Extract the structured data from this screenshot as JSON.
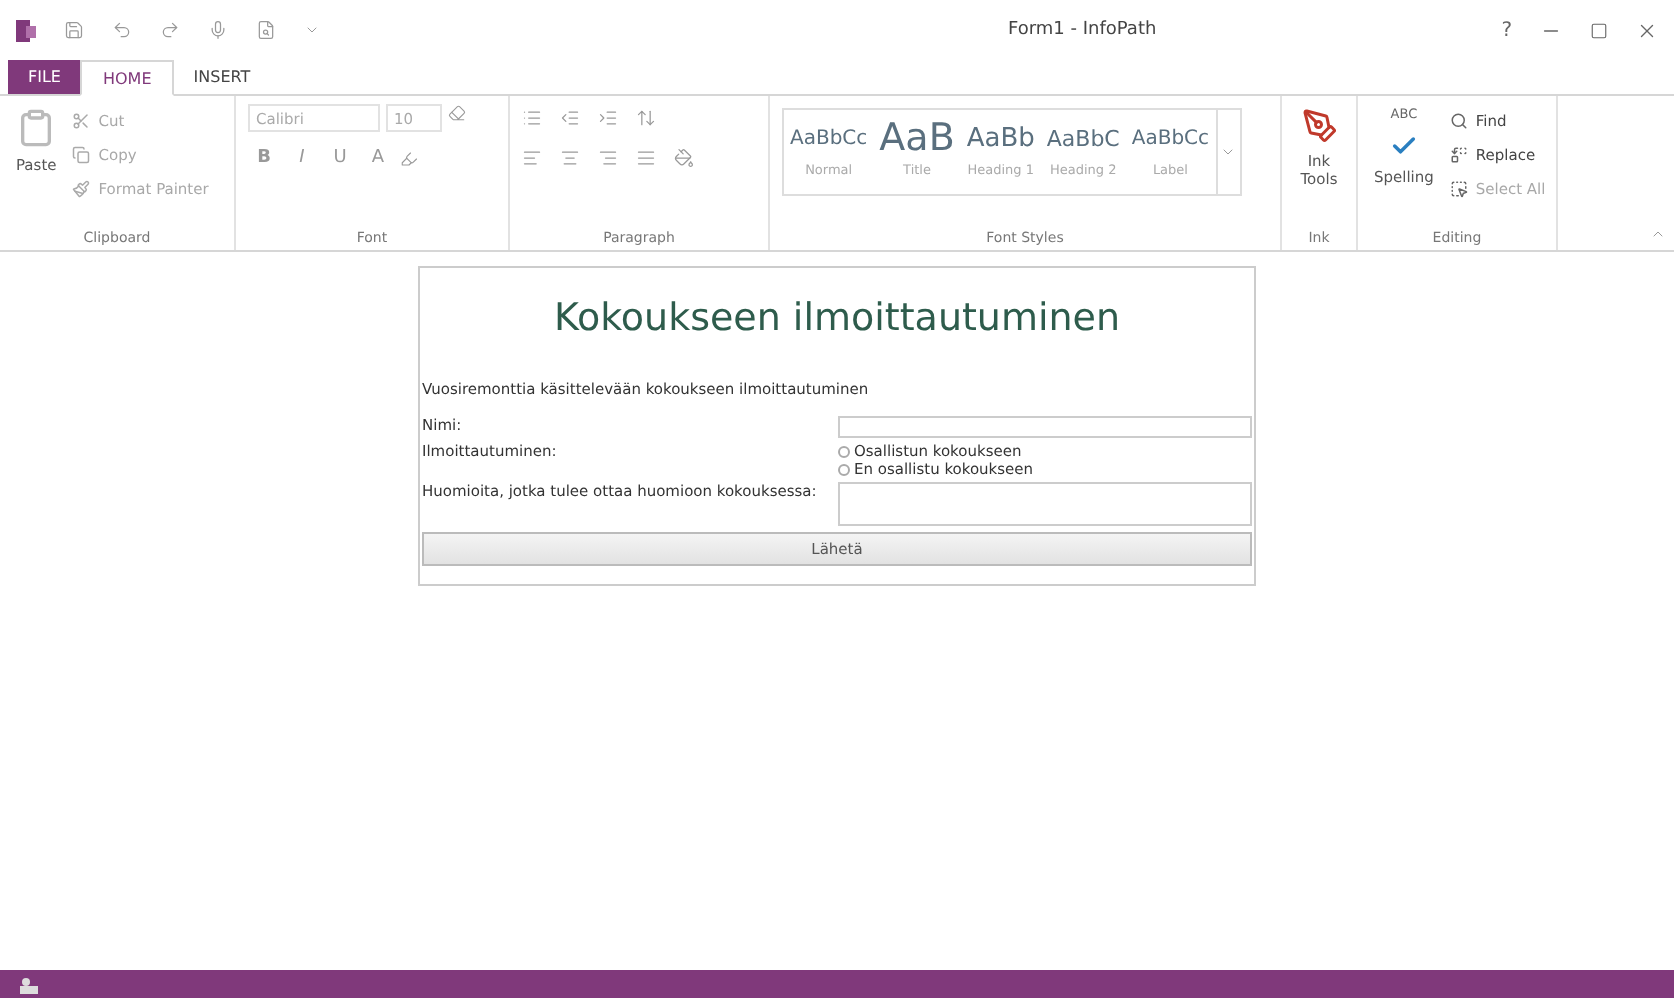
{
  "window": {
    "title": "Form1 - InfoPath",
    "help": "?"
  },
  "tabs": [
    {
      "label": "FILE",
      "kind": "file",
      "selected": false
    },
    {
      "label": "HOME",
      "kind": "tab",
      "selected": true
    },
    {
      "label": "INSERT",
      "kind": "tab",
      "selected": false
    }
  ],
  "clipboard": {
    "label": "Clipboard",
    "paste": "Paste",
    "items": [
      {
        "label": "Cut",
        "disabled": true
      },
      {
        "label": "Copy",
        "disabled": true
      },
      {
        "label": "Format Painter",
        "disabled": true
      }
    ]
  },
  "font": {
    "label": "Font",
    "name": "Calibri",
    "size": "10",
    "buttons": [
      "B",
      "I",
      "U",
      "A"
    ]
  },
  "paragraph": {
    "label": "Paragraph"
  },
  "font_styles": {
    "label": "Font Styles",
    "items": [
      {
        "sample": "AaBbCc",
        "name": "Normal",
        "kind": "normal"
      },
      {
        "sample": "AaB",
        "name": "Title",
        "kind": "title"
      },
      {
        "sample": "AaBb",
        "name": "Heading 1",
        "kind": "h1"
      },
      {
        "sample": "AaBbC",
        "name": "Heading 2",
        "kind": "h2"
      },
      {
        "sample": "AaBbCc",
        "name": "Label",
        "kind": "normal"
      }
    ]
  },
  "ink": {
    "label": "Ink",
    "button": "Ink Tools"
  },
  "editing": {
    "label": "Editing",
    "spelling_mark": "ABC",
    "spelling": "Spelling",
    "items": [
      {
        "label": "Find",
        "disabled": false
      },
      {
        "label": "Replace",
        "disabled": false
      },
      {
        "label": "Select All",
        "disabled": true
      }
    ]
  },
  "form": {
    "title": "Kokoukseen ilmoittautuminen",
    "intro": "Vuosiremonttia käsittelevään kokoukseen ilmoittautuminen",
    "rows": [
      {
        "label": "Nimi:",
        "kind": "text"
      },
      {
        "label": "Ilmoittautuminen:",
        "kind": "radio",
        "options": [
          {
            "label": "Osallistun kokoukseen",
            "selected": false
          },
          {
            "label": "En osallistu kokoukseen",
            "selected": false
          }
        ]
      },
      {
        "label": "Huomioita, jotka tulee ottaa huomioon kokouksessa:",
        "kind": "textarea"
      }
    ],
    "submit": "Lähetä"
  }
}
